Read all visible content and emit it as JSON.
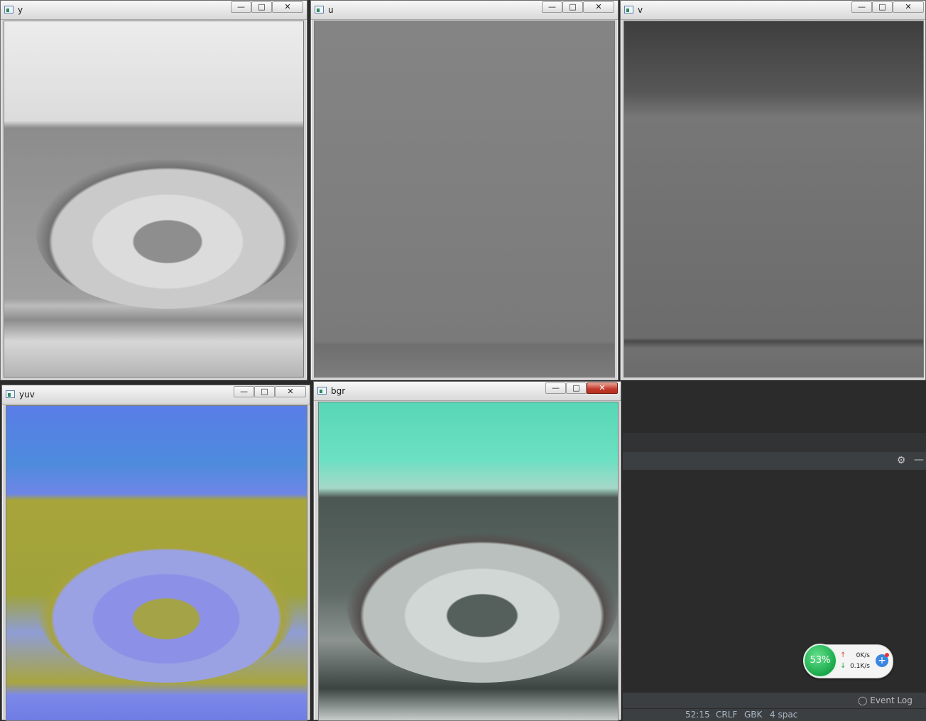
{
  "windows": {
    "y": {
      "title": "y"
    },
    "u": {
      "title": "u"
    },
    "v": {
      "title": "v"
    },
    "yuv": {
      "title": "yuv"
    },
    "bgr": {
      "title": "bgr"
    }
  },
  "window_controls": {
    "minimize": "—",
    "maximize": "□",
    "close": "✕"
  },
  "ide": {
    "settings_icon": "⚙",
    "hide_icon": "—",
    "event_log": "Event Log",
    "status": {
      "position": "52:15",
      "line_separator": "CRLF",
      "encoding": "GBK",
      "indent": "4 spac"
    }
  },
  "net_widget": {
    "cpu_percent": "53%",
    "upload": "0K/s",
    "download": "0.1K/s"
  },
  "colors": {
    "ide_background": "#2b2b2b",
    "close_active": "#c2392b"
  }
}
